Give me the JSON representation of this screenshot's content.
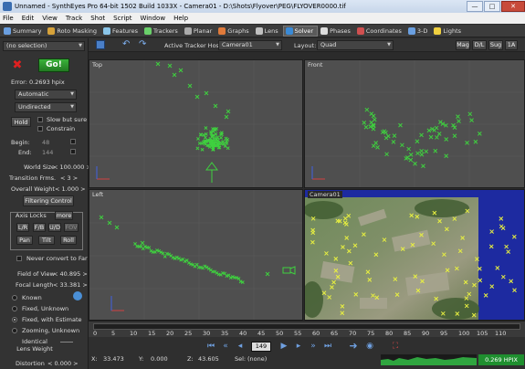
{
  "window": {
    "title": "Unnamed - SynthEyes Pro 64-bit 1502 Build 1033X - Camera01 - D:\\Shots\\Flyover\\PEG\\FLYOVER0000.tif",
    "minimize": "—",
    "maximize": "□",
    "close": "✕"
  },
  "menu": [
    "File",
    "Edit",
    "View",
    "Track",
    "Shot",
    "Script",
    "Window",
    "Help"
  ],
  "rooms": [
    {
      "label": "Summary",
      "icon": "summary-icon",
      "color": "#6a9fe0"
    },
    {
      "label": "Roto Masking",
      "icon": "roto-icon",
      "color": "#d6a23a"
    },
    {
      "label": "Features",
      "icon": "features-icon",
      "color": "#8ac5e8"
    },
    {
      "label": "Trackers",
      "icon": "trackers-icon",
      "color": "#6ad06a"
    },
    {
      "label": "Planar",
      "icon": "planar-icon",
      "color": "#aaaaaa"
    },
    {
      "label": "Graphs",
      "icon": "graphs-icon",
      "color": "#e07a3a"
    },
    {
      "label": "Lens",
      "icon": "lens-icon",
      "color": "#c0c0c0"
    },
    {
      "label": "Solver",
      "icon": "solver-icon",
      "color": "#3a8ad6"
    },
    {
      "label": "Phases",
      "icon": "phases-icon",
      "color": "#dddddd"
    },
    {
      "label": "Coordinates",
      "icon": "coordinates-icon",
      "color": "#d05050"
    },
    {
      "label": "3-D",
      "icon": "3d-icon",
      "color": "#6a9fe0"
    },
    {
      "label": "Lights",
      "icon": "lights-icon",
      "color": "#f0d040"
    }
  ],
  "active_room": "Solver",
  "left": {
    "selection": "(no selection)",
    "go_label": "Go!",
    "error_label": "Error:",
    "error_value": "0.2693 hpix",
    "mode": "Automatic",
    "direction": "Undirected",
    "hold": "Hold",
    "slow_but_sure": "Slow but sure",
    "constrain": "Constrain",
    "begin_label": "Begin:",
    "begin_value": "48",
    "end_label": "End:",
    "end_value": "144",
    "world_size_label": "World Size",
    "world_size_value": "< 100.000 >",
    "transition_label": "Transition Frms.",
    "transition_value": "< 3 >",
    "overall_weight_label": "Overall Weight",
    "overall_weight_value": "< 1.000 >",
    "filtering_control": "Filtering Control",
    "axis_locks": "Axis Locks",
    "more": "more",
    "lock_buttons": [
      "L/R",
      "F/B",
      "U/D",
      "FOV"
    ],
    "pan": "Pan",
    "tilt": "Tilt",
    "roll": "Roll",
    "never_convert": "Never convert to Far",
    "fov_label": "Field of View",
    "fov_value": "< 40.895 >",
    "focal_label": "Focal Length",
    "focal_value": "< 33.381 >",
    "lens_modes": [
      "Known",
      "Fixed, Unknown",
      "Fixed, with Estimate",
      "Zooming, Unknown"
    ],
    "lens_mode_selected": "Fixed, with Estimate",
    "identical_lens_weight": "Identical Lens Weight",
    "distortion_label": "Distortion",
    "distortion_value": "< 0.000 >"
  },
  "toolbar": {
    "active_tracker_host_label": "Active Tracker Host:",
    "active_tracker_host": "Camera01",
    "layout_label": "Layout:",
    "layout": "Quad",
    "buttons": [
      "Mag",
      "D/L",
      "Sug",
      "1A"
    ]
  },
  "viewports": {
    "top": "Top",
    "front": "Front",
    "left": "Left",
    "camera": "Camera01"
  },
  "timeline": {
    "ticks": [
      "0",
      "5",
      "10",
      "15",
      "20",
      "25",
      "30",
      "35",
      "40",
      "45",
      "50",
      "55",
      "60",
      "65",
      "70",
      "75",
      "80",
      "85",
      "90",
      "95",
      "100",
      "105",
      "110"
    ]
  },
  "bottom": {
    "frame": "149",
    "x_label": "X:",
    "x_value": "33.473",
    "y_label": "Y:",
    "y_value": "0.000",
    "z_label": "Z:",
    "z_value": "43.605",
    "sel_label": "Sel:",
    "sel_value": "(none)",
    "hpix": "0.269 HPIX"
  },
  "colors": {
    "tracker_green": "#3fd03f",
    "tracker_yellow": "#e8f040",
    "go_green": "#2f9a2f",
    "delete_red": "#d02020",
    "hpix_green": "#1f8f2f"
  }
}
